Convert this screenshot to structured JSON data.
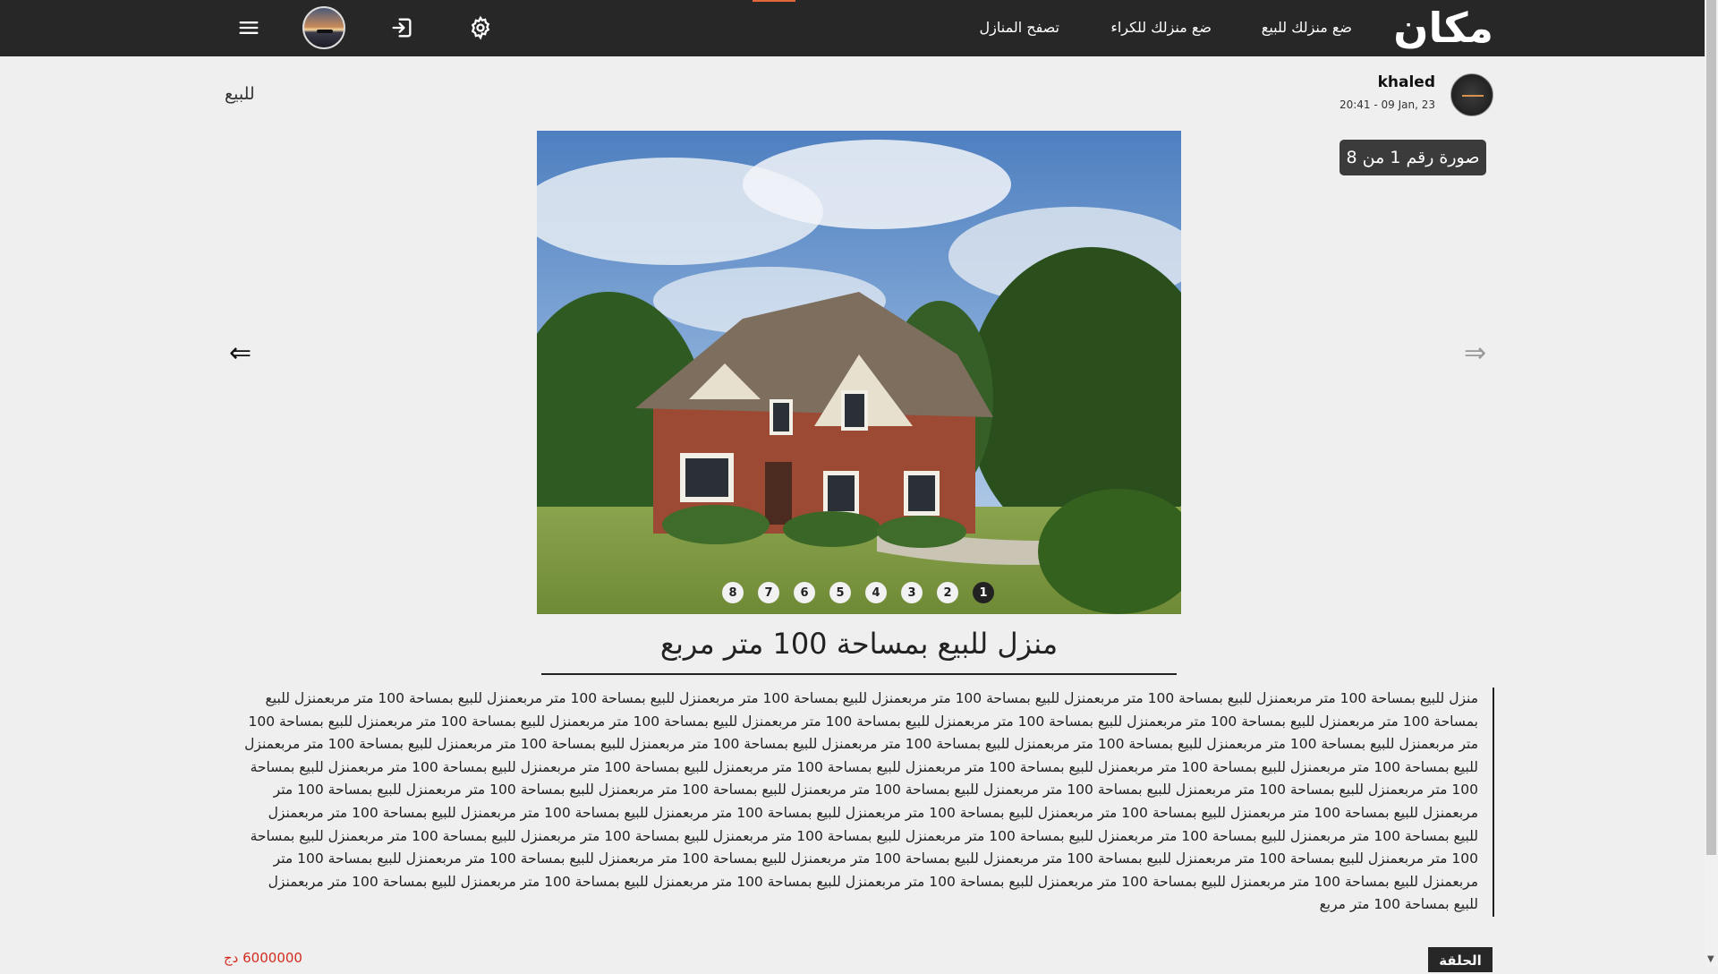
{
  "nav": {
    "logo": "مكان",
    "links": [
      "ضع منزلك للبيع",
      "ضع منزلك للكراء",
      "تصفح المنازل"
    ],
    "icons": [
      "gear-icon",
      "logout-icon",
      "avatar",
      "menu-icon"
    ]
  },
  "poster": {
    "name": "khaled",
    "date": "20:41 - 09 Jan, 23"
  },
  "listing": {
    "status": "للبيع",
    "image_counter": "صورة رقم 1 من 8",
    "dots": [
      "1",
      "2",
      "3",
      "4",
      "5",
      "6",
      "7",
      "8"
    ],
    "active_dot": 1,
    "prev_arrow": "⇐",
    "next_arrow": "⇒",
    "title": "منزل للبيع بمساحة 100 متر مربع",
    "description": "منزل للبيع بمساحة 100 متر مربعمنزل للبيع بمساحة 100 متر مربعمنزل للبيع بمساحة 100 متر مربعمنزل للبيع بمساحة 100 متر مربعمنزل للبيع بمساحة 100 متر مربعمنزل للبيع بمساحة 100 متر مربعمنزل للبيع بمساحة 100 متر مربعمنزل للبيع بمساحة 100 متر مربعمنزل للبيع بمساحة 100 متر مربعمنزل للبيع بمساحة 100 متر مربعمنزل للبيع بمساحة 100 متر مربعمنزل للبيع بمساحة 100 متر مربعمنزل للبيع بمساحة 100 متر مربعمنزل للبيع بمساحة 100 متر مربعمنزل للبيع بمساحة 100 متر مربعمنزل للبيع بمساحة 100 متر مربعمنزل للبيع بمساحة 100 متر مربعمنزل للبيع بمساحة 100 متر مربعمنزل للبيع بمساحة 100 متر مربعمنزل للبيع بمساحة 100 متر مربعمنزل للبيع بمساحة 100 متر مربعمنزل للبيع بمساحة 100 متر مربعمنزل للبيع بمساحة 100 متر مربعمنزل للبيع بمساحة 100 متر مربعمنزل للبيع بمساحة 100 متر مربعمنزل للبيع بمساحة 100 متر مربعمنزل للبيع بمساحة 100 متر مربعمنزل للبيع بمساحة 100 متر مربعمنزل للبيع بمساحة 100 متر مربعمنزل للبيع بمساحة 100 متر مربعمنزل للبيع بمساحة 100 متر مربعمنزل للبيع بمساحة 100 متر مربعمنزل للبيع بمساحة 100 متر مربعمنزل للبيع بمساحة 100 متر مربعمنزل للبيع بمساحة 100 متر مربعمنزل للبيع بمساحة 100 متر مربعمنزل للبيع بمساحة 100 متر مربعمنزل للبيع بمساحة 100 متر مربعمنزل للبيع بمساحة 100 متر مربعمنزل للبيع بمساحة 100 متر مربعمنزل للبيع بمساحة 100 متر مربعمنزل للبيع بمساحة 100 متر مربعمنزل للبيع بمساحة 100 متر مربعمنزل للبيع بمساحة 100 متر مربعمنزل للبيع بمساحة 100 متر مربعمنزل للبيع بمساحة 100 متر مربعمنزل للبيع بمساحة 100 متر مربعمنزل للبيع بمساحة 100 متر مربعمنزل للبيع بمساحة 100 متر مربعمنزل للبيع بمساحة 100 متر مربعمنزل للبيع بمساحة 100 متر مربعمنزل للبيع بمساحة 100 متر مربعمنزل للبيع بمساحة 100 متر مربعمنزل للبيع بمساحة 100 متر مربعمنزل للبيع بمساحة 100 متر مربعمنزل للبيع بمساحة 100 متر مربعمنزل للبيع بمساحة 100 متر مربعمنزل للبيع بمساحة 100 متر مربع",
    "price": "6000000 دج",
    "tag": "الحلقة"
  },
  "colors": {
    "navbar_bg": "#272727",
    "page_bg": "#efefef",
    "price": "#d42c1f",
    "accent": "#e2673a"
  }
}
